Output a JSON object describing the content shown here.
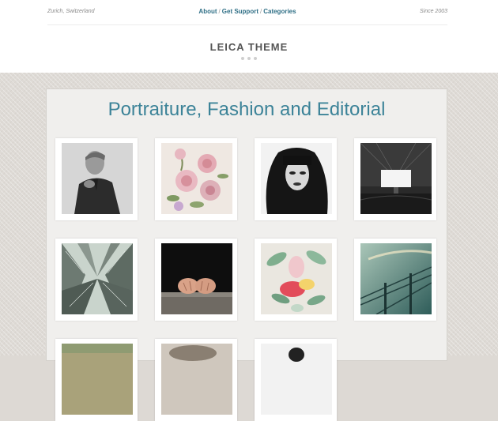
{
  "header": {
    "location": "Zurich, Switzerland",
    "nav": [
      {
        "label": "About"
      },
      {
        "label": "Get Support"
      },
      {
        "label": "Categories"
      }
    ],
    "nav_separator": "/",
    "since": "Since 2003",
    "brand": "LEICA THEME"
  },
  "gallery": {
    "title": "Portraiture, Fashion and Editorial",
    "items": [
      {
        "subject": "man in dark shirt smoking"
      },
      {
        "subject": "pink flower bouquet illustration"
      },
      {
        "subject": "woman with dark hair black and white"
      },
      {
        "subject": "drive-in movie screen at night"
      },
      {
        "subject": "city skyscrapers from below"
      },
      {
        "subject": "hands clasped on table"
      },
      {
        "subject": "tropical flowers illustration"
      },
      {
        "subject": "railway overhead wires teal sky"
      },
      {
        "subject": "landscape partial"
      },
      {
        "subject": "bird feathers partial"
      },
      {
        "subject": "figure portrait partial"
      }
    ]
  },
  "colors": {
    "accent": "#3c8398",
    "nav": "#2f6f86",
    "brand": "#555555"
  }
}
